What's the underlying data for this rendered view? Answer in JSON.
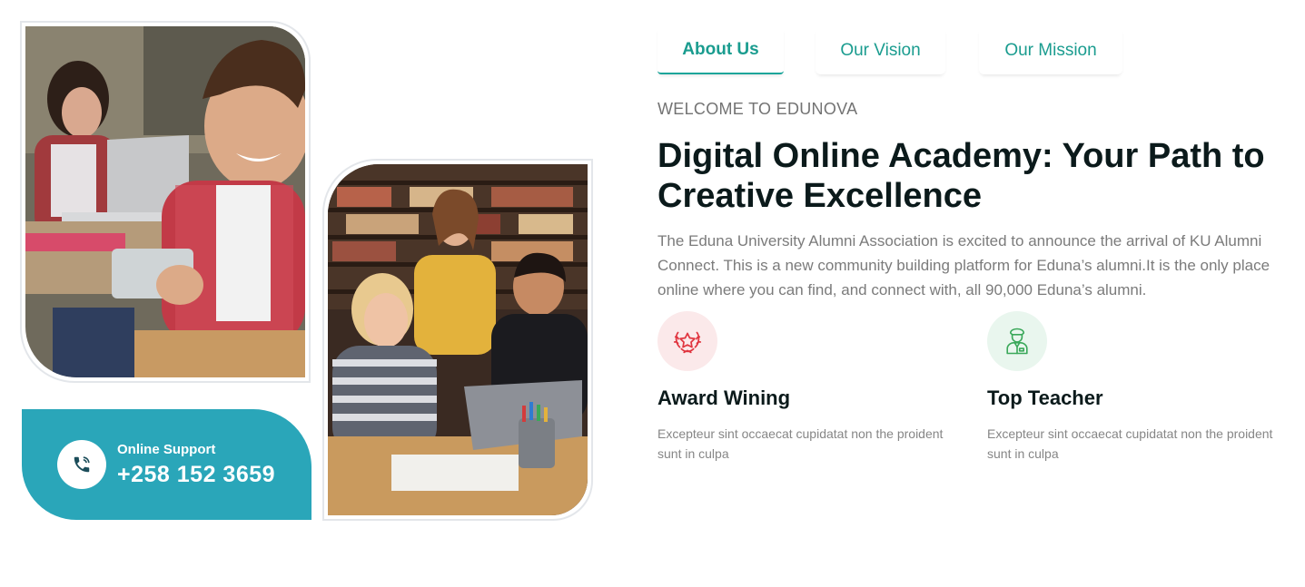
{
  "photos": {
    "student_photo": "smiling student with tablet in classroom",
    "group_photo": "students studying with laptop in library"
  },
  "support": {
    "label": "Online Support",
    "number": "+258 152 3659",
    "icon": "phone-icon"
  },
  "tabs": [
    {
      "label": "About Us",
      "active": true
    },
    {
      "label": "Our Vision",
      "active": false
    },
    {
      "label": "Our Mission",
      "active": false
    }
  ],
  "about": {
    "eyebrow": "WELCOME TO EDUNOVA",
    "headline": "Digital Online Academy: Your Path to Creative Excellence",
    "intro": "The Eduna University Alumni Association is excited to announce the arrival of KU Alumni Connect. This is a new community building platform for Eduna’s alumni.It is the only place online where you can find, and connect with, all 90,000 Eduna’s alumni."
  },
  "features": [
    {
      "icon": "award-icon",
      "title": "Award Wining",
      "text": "Excepteur sint occaecat cupidatat non the proident sunt in culpa"
    },
    {
      "icon": "teacher-icon",
      "title": "Top Teacher",
      "text": "Excepteur sint occaecat cupidatat non the proident sunt in culpa"
    }
  ],
  "colors": {
    "accent": "#1a9c8f",
    "support_bg": "#2aa6b9",
    "award_bg": "#fbe9ea",
    "award_icon": "#e0353f",
    "teacher_bg": "#e9f6ee",
    "teacher_icon": "#3aa85a"
  }
}
